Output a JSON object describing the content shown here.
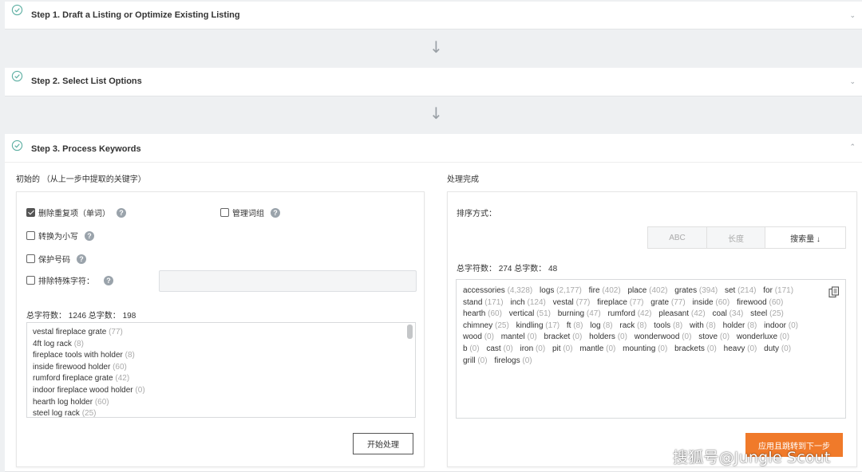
{
  "steps": {
    "step1": {
      "title": "Step 1. Draft a Listing or Optimize Existing Listing"
    },
    "step2": {
      "title": "Step 2. Select List Options"
    },
    "step3": {
      "title": "Step 3. Process Keywords"
    }
  },
  "icons": {
    "check": "check-circle-icon",
    "collapse": "chevron-down-icon",
    "expand": "chevron-up-icon",
    "arrow": "arrow-down-icon",
    "help": "help-icon",
    "copy": "copy-icon"
  },
  "colors": {
    "accent": "#f07a2a",
    "check": "#5fb0a3"
  },
  "left": {
    "title": "初始的 （从上一步中提取的关键字）",
    "options": {
      "dedupe": {
        "label": "删除重复项（单词）",
        "checked": true
      },
      "manage_phrases": {
        "label": "管理词组",
        "checked": false
      },
      "lowercase": {
        "label": "转换为小写",
        "checked": false
      },
      "protect_numbers": {
        "label": "保护号码",
        "checked": false
      },
      "exclude_special": {
        "label": "排除特殊字符：",
        "checked": false
      }
    },
    "exclude_value": "",
    "stats": "总字符数： 1246 总字数： 198",
    "keywords": [
      {
        "text": "vestal fireplace grate",
        "count": "(77)"
      },
      {
        "text": "4ft log rack",
        "count": "(8)"
      },
      {
        "text": "fireplace tools with holder",
        "count": "(8)"
      },
      {
        "text": "inside firewood holder",
        "count": "(60)"
      },
      {
        "text": "rumford fireplace grate",
        "count": "(42)"
      },
      {
        "text": "indoor fireplace wood holder",
        "count": "(0)"
      },
      {
        "text": "hearth log holder",
        "count": "(60)"
      },
      {
        "text": "steel log rack",
        "count": "(25)"
      }
    ],
    "start_button": "开始处理"
  },
  "right": {
    "title": "处理完成",
    "sort_label": "排序方式：",
    "sort_options": [
      "ABC",
      "长度",
      "搜索量 ↓"
    ],
    "sort_active": 2,
    "stats": "总字符数： 274 总字数： 48",
    "words": [
      {
        "w": "accessories",
        "c": "(4,328)"
      },
      {
        "w": "logs",
        "c": "(2,177)"
      },
      {
        "w": "fire",
        "c": "(402)"
      },
      {
        "w": "place",
        "c": "(402)"
      },
      {
        "w": "grates",
        "c": "(394)"
      },
      {
        "w": "set",
        "c": "(214)"
      },
      {
        "w": "for",
        "c": "(171)"
      },
      {
        "w": "stand",
        "c": "(171)"
      },
      {
        "w": "inch",
        "c": "(124)"
      },
      {
        "w": "vestal",
        "c": "(77)"
      },
      {
        "w": "fireplace",
        "c": "(77)"
      },
      {
        "w": "grate",
        "c": "(77)"
      },
      {
        "w": "inside",
        "c": "(60)"
      },
      {
        "w": "firewood",
        "c": "(60)"
      },
      {
        "w": "hearth",
        "c": "(60)"
      },
      {
        "w": "vertical",
        "c": "(51)"
      },
      {
        "w": "burning",
        "c": "(47)"
      },
      {
        "w": "rumford",
        "c": "(42)"
      },
      {
        "w": "pleasant",
        "c": "(42)"
      },
      {
        "w": "coal",
        "c": "(34)"
      },
      {
        "w": "steel",
        "c": "(25)"
      },
      {
        "w": "chimney",
        "c": "(25)"
      },
      {
        "w": "kindling",
        "c": "(17)"
      },
      {
        "w": "ft",
        "c": "(8)"
      },
      {
        "w": "log",
        "c": "(8)"
      },
      {
        "w": "rack",
        "c": "(8)"
      },
      {
        "w": "tools",
        "c": "(8)"
      },
      {
        "w": "with",
        "c": "(8)"
      },
      {
        "w": "holder",
        "c": "(8)"
      },
      {
        "w": "indoor",
        "c": "(0)"
      },
      {
        "w": "wood",
        "c": "(0)"
      },
      {
        "w": "mantel",
        "c": "(0)"
      },
      {
        "w": "bracket",
        "c": "(0)"
      },
      {
        "w": "holders",
        "c": "(0)"
      },
      {
        "w": "wonderwood",
        "c": "(0)"
      },
      {
        "w": "stove",
        "c": "(0)"
      },
      {
        "w": "wonderluxe",
        "c": "(0)"
      },
      {
        "w": "b",
        "c": "(0)"
      },
      {
        "w": "cast",
        "c": "(0)"
      },
      {
        "w": "iron",
        "c": "(0)"
      },
      {
        "w": "pit",
        "c": "(0)"
      },
      {
        "w": "mantle",
        "c": "(0)"
      },
      {
        "w": "mounting",
        "c": "(0)"
      },
      {
        "w": "brackets",
        "c": "(0)"
      },
      {
        "w": "heavy",
        "c": "(0)"
      },
      {
        "w": "duty",
        "c": "(0)"
      },
      {
        "w": "grill",
        "c": "(0)"
      },
      {
        "w": "firelogs",
        "c": "(0)"
      }
    ],
    "apply_button": "应用且跳转到下一步"
  },
  "watermark": "搜狐号@Jungle Scout"
}
